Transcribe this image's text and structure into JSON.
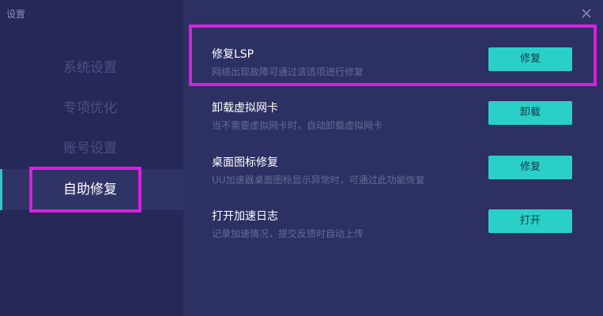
{
  "window": {
    "title": "设置"
  },
  "sidebar": {
    "items": [
      {
        "label": "系统设置"
      },
      {
        "label": "专项优化"
      },
      {
        "label": "账号设置"
      },
      {
        "label": "自助修复"
      }
    ],
    "active": "自助修复"
  },
  "main": {
    "items": [
      {
        "title": "修复LSP",
        "desc": "网络出现故障可通过该选项进行修复",
        "button": "修复"
      },
      {
        "title": "卸载虚拟网卡",
        "desc": "当不需要虚拟网卡时，自动卸载虚拟网卡",
        "button": "卸载"
      },
      {
        "title": "桌面图标修复",
        "desc": "UU加速器桌面图标显示异常时，可通过此功能恢复",
        "button": "修复"
      },
      {
        "title": "打开加速日志",
        "desc": "记录加速情况，提交反馈时自动上传",
        "button": "打开"
      }
    ]
  },
  "colors": {
    "accent": "#2ad0c8",
    "highlight": "#d81fe0",
    "sidebar_bg": "#262858",
    "main_bg": "#2d3062"
  },
  "icons": {
    "close": "close-icon"
  }
}
